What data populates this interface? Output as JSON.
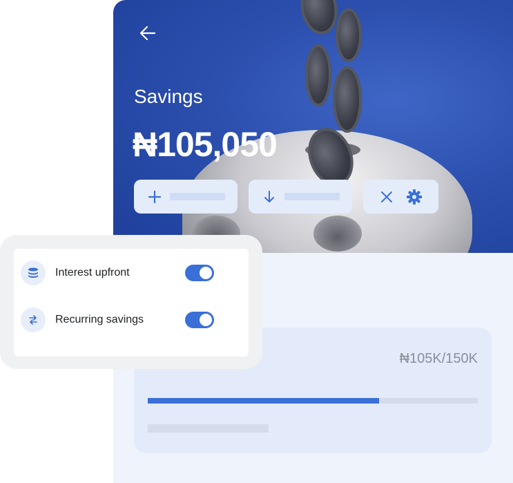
{
  "header": {
    "title": "Savings",
    "balance": "₦105,050"
  },
  "actions": [
    {
      "name": "add",
      "icon": "plus-icon"
    },
    {
      "name": "withdraw",
      "icon": "arrow-down-icon"
    },
    {
      "name": "close-settings",
      "icons": [
        "close-icon",
        "gear-icon"
      ]
    }
  ],
  "settings": {
    "items": [
      {
        "label": "Interest upfront",
        "icon": "coins-stack-icon",
        "enabled": true
      },
      {
        "label": "Recurring savings",
        "icon": "repeat-icon",
        "enabled": true
      }
    ]
  },
  "goal": {
    "progress_text": "₦105K/150K",
    "progress": 0.7
  },
  "colors": {
    "accent": "#3a6fd8",
    "hero_bg": "#2c4fae",
    "card_bg": "#eef3fc"
  }
}
